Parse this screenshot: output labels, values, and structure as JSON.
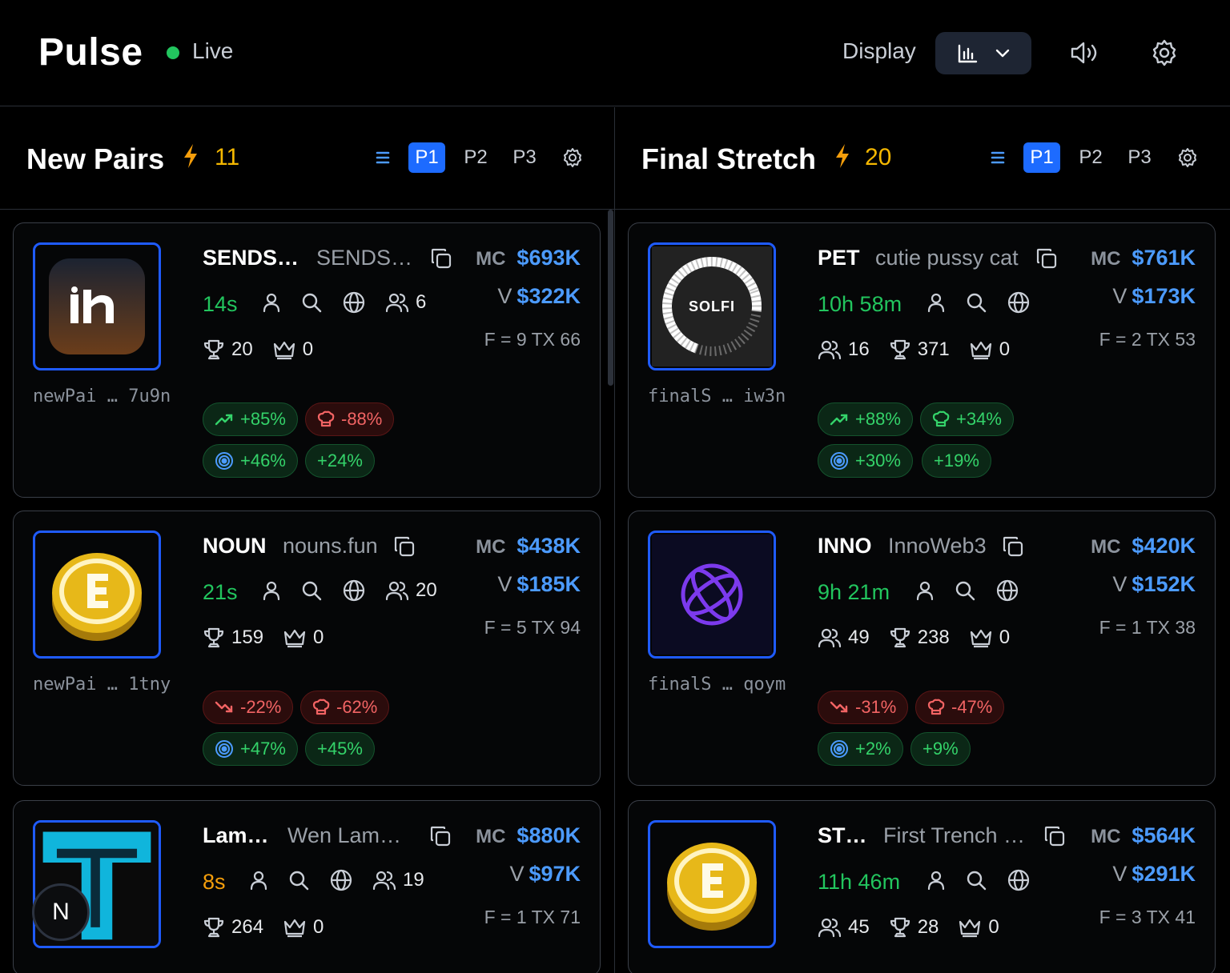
{
  "header": {
    "brand": "Pulse",
    "live": "Live",
    "display_label": "Display"
  },
  "columns": [
    {
      "title": "New Pairs",
      "count": "11",
      "tabs": [
        "P1",
        "P2",
        "P3"
      ],
      "active_tab": "P1",
      "cards": [
        {
          "ticker": "SENDS…",
          "name": "SENDS…",
          "age": "14s",
          "holders": "6",
          "trophies": "20",
          "crowns": "0",
          "mc": "$693K",
          "vol": "$322K",
          "ftx": "F = 9 TX 66",
          "addr": "newPai … 7u9n",
          "pills": [
            {
              "icon": "trend-up",
              "val": "+85%",
              "tone": "green"
            },
            {
              "icon": "chef",
              "val": "-88%",
              "tone": "red"
            },
            {
              "icon": "target",
              "val": "+46%",
              "tone": "green"
            },
            {
              "icon": "",
              "val": "+24%",
              "tone": "green"
            }
          ]
        },
        {
          "ticker": "NOUN",
          "name": "nouns.fun",
          "age": "21s",
          "holders": "20",
          "trophies": "159",
          "crowns": "0",
          "mc": "$438K",
          "vol": "$185K",
          "ftx": "F = 5 TX 94",
          "addr": "newPai … 1tny",
          "pills": [
            {
              "icon": "trend-down",
              "val": "-22%",
              "tone": "red"
            },
            {
              "icon": "chef",
              "val": "-62%",
              "tone": "red"
            },
            {
              "icon": "target",
              "val": "+47%",
              "tone": "green"
            },
            {
              "icon": "",
              "val": "+45%",
              "tone": "green"
            }
          ]
        },
        {
          "ticker": "Lam…",
          "name": "Wen Lam…",
          "age": "8s",
          "holders": "19",
          "trophies": "264",
          "crowns": "0",
          "mc": "$880K",
          "vol": "$97K",
          "ftx": "F = 1 TX 71",
          "addr": "",
          "pills": []
        }
      ]
    },
    {
      "title": "Final Stretch",
      "count": "20",
      "tabs": [
        "P1",
        "P2",
        "P3"
      ],
      "active_tab": "P1",
      "cards": [
        {
          "ticker": "PET",
          "name": "cutie pussy cat",
          "age": "10h 58m",
          "holders": "16",
          "trophies": "371",
          "crowns": "0",
          "mc": "$761K",
          "vol": "$173K",
          "ftx": "F = 2 TX 53",
          "addr": "finalS … iw3n",
          "logo_text": "SOLFI",
          "pills": [
            {
              "icon": "trend-up",
              "val": "+88%",
              "tone": "green"
            },
            {
              "icon": "chef",
              "val": "+34%",
              "tone": "green"
            },
            {
              "icon": "target",
              "val": "+30%",
              "tone": "green"
            },
            {
              "icon": "",
              "val": "+19%",
              "tone": "green"
            }
          ]
        },
        {
          "ticker": "INNO",
          "name": "InnoWeb3",
          "age": "9h 21m",
          "holders": "49",
          "trophies": "238",
          "crowns": "0",
          "mc": "$420K",
          "vol": "$152K",
          "ftx": "F = 1 TX 38",
          "addr": "finalS … qoym",
          "pills": [
            {
              "icon": "trend-down",
              "val": "-31%",
              "tone": "red"
            },
            {
              "icon": "chef",
              "val": "-47%",
              "tone": "red"
            },
            {
              "icon": "target",
              "val": "+2%",
              "tone": "green"
            },
            {
              "icon": "",
              "val": "+9%",
              "tone": "green"
            }
          ]
        },
        {
          "ticker": "ST…",
          "name": "First Trench …",
          "age": "11h 46m",
          "holders": "45",
          "trophies": "28",
          "crowns": "0",
          "mc": "$564K",
          "vol": "$291K",
          "ftx": "F = 3 TX 41",
          "addr": "",
          "pills": []
        }
      ]
    }
  ],
  "labels": {
    "mc": "MC",
    "v": "V"
  },
  "fab": "N",
  "colors": {
    "accent": "#1d6bff",
    "positive": "#22c55e",
    "negative": "#f26464",
    "value": "#4c9bff",
    "warning": "#f5b800"
  }
}
